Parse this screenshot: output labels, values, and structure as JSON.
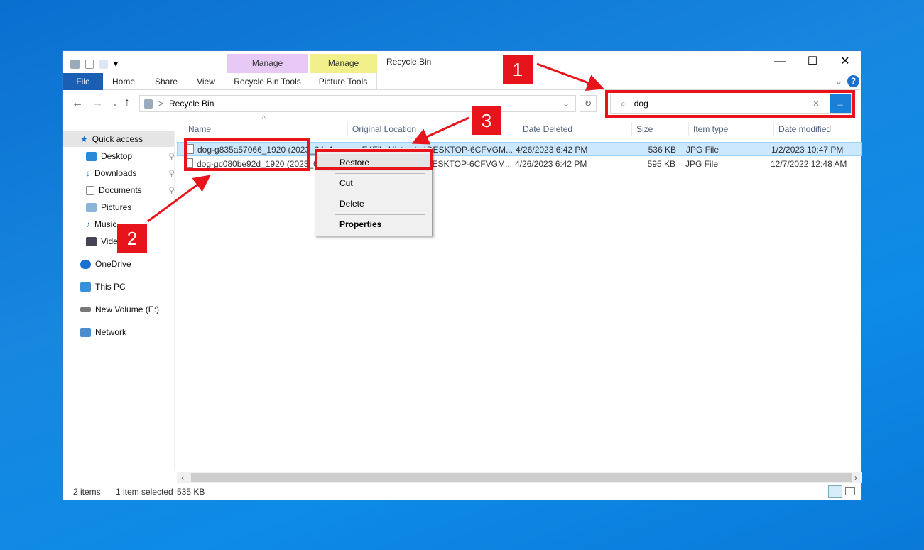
{
  "window": {
    "title": "Recycle Bin",
    "minimize": "—",
    "maximize": "☐",
    "close": "✕"
  },
  "ribbon": {
    "tabs": [
      "File",
      "Home",
      "Share",
      "View"
    ],
    "context": [
      {
        "group": "Manage",
        "tab": "Recycle Bin Tools",
        "color": "#e8c9f6"
      },
      {
        "group": "Manage",
        "tab": "Picture Tools",
        "color": "#f2f08a"
      }
    ],
    "help": "?"
  },
  "address": {
    "path": "Recycle Bin",
    "separator": ">"
  },
  "search": {
    "value": "dog"
  },
  "sidebar": {
    "items": [
      {
        "label": "Quick access",
        "icon": "star-icon"
      },
      {
        "label": "Desktop",
        "icon": "desktop-icon",
        "pinned": true
      },
      {
        "label": "Downloads",
        "icon": "downloads-icon",
        "pinned": true
      },
      {
        "label": "Documents",
        "icon": "documents-icon",
        "pinned": true
      },
      {
        "label": "Pictures",
        "icon": "pictures-icon"
      },
      {
        "label": "Music",
        "icon": "music-icon"
      },
      {
        "label": "Videos",
        "icon": "videos-icon"
      },
      {
        "label": "OneDrive",
        "icon": "cloud-icon"
      },
      {
        "label": "This PC",
        "icon": "computer-icon"
      },
      {
        "label": "New Volume (E:)",
        "icon": "drive-icon"
      },
      {
        "label": "Network",
        "icon": "network-icon"
      }
    ]
  },
  "columns": [
    "Name",
    "Original Location",
    "Date Deleted",
    "Size",
    "Item type",
    "Date modified"
  ],
  "files": [
    {
      "name": "dog-g835a57066_1920 (2023_04_18",
      "location": "E:\\File History\\...\\DESKTOP-6CFVGM...",
      "deleted": "4/26/2023 6:42 PM",
      "size": "536 KB",
      "type": "JPG File",
      "modified": "1/2/2023 10:47 PM",
      "selected": true
    },
    {
      "name": "dog-gc080be92d_1920 (2023_04_18",
      "location": "E:\\File History\\...\\DESKTOP-6CFVGM...",
      "deleted": "4/26/2023 6:42 PM",
      "size": "595 KB",
      "type": "JPG File",
      "modified": "12/7/2022 12:48 AM",
      "selected": false
    }
  ],
  "context_menu": [
    "Restore",
    "Cut",
    "Delete",
    "Properties"
  ],
  "status": {
    "count": "2 items",
    "selection": "1 item selected",
    "size": "535 KB"
  },
  "annotations": [
    "1",
    "2",
    "3"
  ],
  "colors": {
    "accent": "#1a5fb4",
    "annotation": "#e8141b",
    "selection": "#cce8ff"
  }
}
